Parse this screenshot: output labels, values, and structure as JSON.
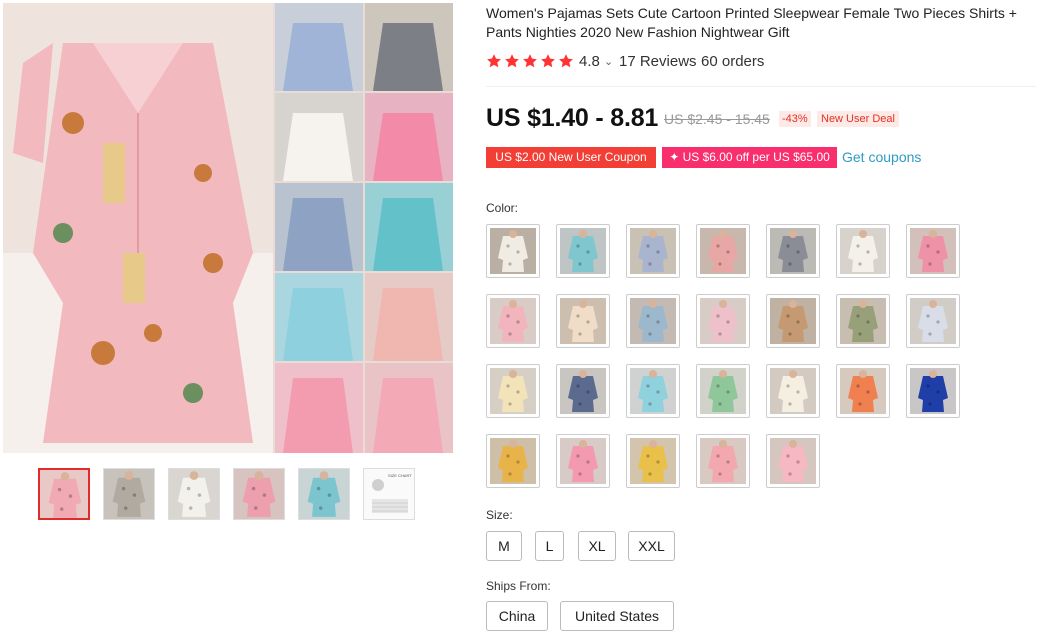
{
  "title": "Women's Pajamas Sets Cute Cartoon Printed Sleepwear Female Two Pieces Shirts + Pants Nighties 2020 New Fashion Nightwear Gift",
  "rating": {
    "stars": 5,
    "value": "4.8",
    "reviews": "17 Reviews",
    "orders": "60 orders"
  },
  "price": {
    "current": "US $1.40 - 8.81",
    "original": "US $2.45 - 15.45",
    "discount": "-43%",
    "badge": "New User Deal"
  },
  "coupons": {
    "coupon1": "US $2.00 New User Coupon",
    "coupon2": "✦ US $6.00 off per US $65.00",
    "get_label": "Get coupons"
  },
  "color": {
    "label": "Color:",
    "swatches": [
      {
        "bg": "#b9b0a3",
        "shirt": "#f0ece4"
      },
      {
        "bg": "#bfc4c4",
        "shirt": "#7fc6cf"
      },
      {
        "bg": "#c9c1b3",
        "shirt": "#a9b5cf"
      },
      {
        "bg": "#c8b7ad",
        "shirt": "#e8a6a4"
      },
      {
        "bg": "#bcbab5",
        "shirt": "#8a8d96"
      },
      {
        "bg": "#d7d2cc",
        "shirt": "#f4f1ea"
      },
      {
        "bg": "#d3c0bb",
        "shirt": "#ee92a8"
      },
      {
        "bg": "#d9ccc6",
        "shirt": "#f2b4bd"
      },
      {
        "bg": "#cdbfb0",
        "shirt": "#f1dcc8"
      },
      {
        "bg": "#c2bab3",
        "shirt": "#9cb8cc"
      },
      {
        "bg": "#d7ccc6",
        "shirt": "#eec0c9"
      },
      {
        "bg": "#bfb2a3",
        "shirt": "#c59a72"
      },
      {
        "bg": "#c7beb1",
        "shirt": "#98a07a"
      },
      {
        "bg": "#d1ccc6",
        "shirt": "#d8dde8"
      },
      {
        "bg": "#d6cfc6",
        "shirt": "#f2e3b8"
      },
      {
        "bg": "#c9c6c2",
        "shirt": "#5b6a8f"
      },
      {
        "bg": "#cfd2d1",
        "shirt": "#8fd1dd"
      },
      {
        "bg": "#d1d3cb",
        "shirt": "#8fc79a"
      },
      {
        "bg": "#d3cbc1",
        "shirt": "#f5efe2"
      },
      {
        "bg": "#d6c9be",
        "shirt": "#f08050"
      },
      {
        "bg": "#c8c6c6",
        "shirt": "#1f3ea8"
      },
      {
        "bg": "#cdbfa8",
        "shirt": "#e8b44a"
      },
      {
        "bg": "#d8cbc7",
        "shirt": "#f49ab0"
      },
      {
        "bg": "#d3c4ad",
        "shirt": "#e9c04a"
      },
      {
        "bg": "#d8c9c2",
        "shirt": "#f3a8b0"
      },
      {
        "bg": "#d6c6c0",
        "shirt": "#f6b8c2"
      }
    ]
  },
  "size": {
    "label": "Size:",
    "options": [
      "M",
      "L",
      "XL",
      "XXL"
    ]
  },
  "ships": {
    "label": "Ships From:",
    "options": [
      "China",
      "United States"
    ]
  },
  "gallery": {
    "main_bg": "#e9dcd6",
    "thumbs": [
      {
        "bg": "#e8c9c6",
        "shirt": "#f1a9b3"
      },
      {
        "bg": "#c7c2bb",
        "shirt": "#b0aaa0"
      },
      {
        "bg": "#d9d6d2",
        "shirt": "#f3f1ec"
      },
      {
        "bg": "#d7c3bf",
        "shirt": "#ee9fae"
      },
      {
        "bg": "#c9d4d5",
        "shirt": "#7cc5cf"
      },
      {
        "bg": "#f4f4f4",
        "shirt": "#ffffff"
      }
    ],
    "size_chart_text": "SIZE CHART"
  }
}
